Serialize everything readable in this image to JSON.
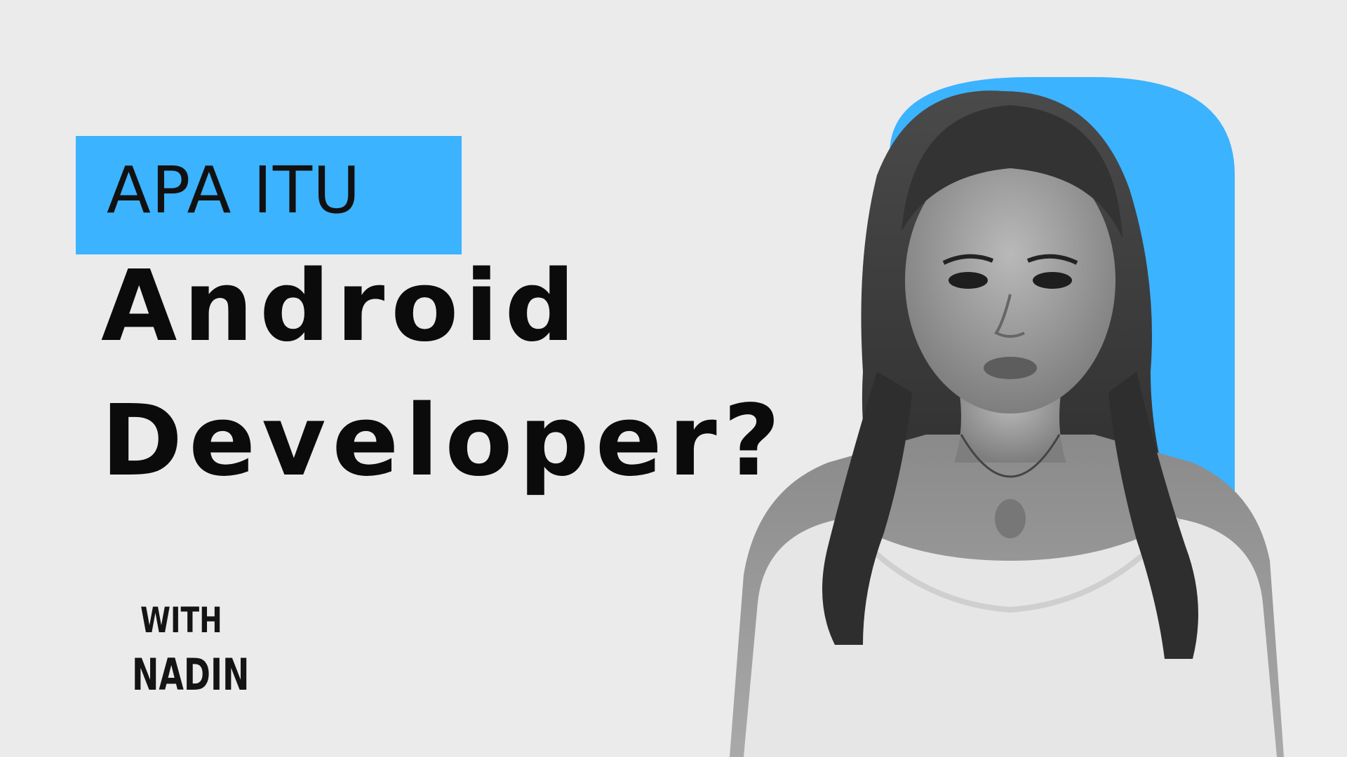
{
  "thumbnail": {
    "kicker": "APA ITU",
    "headline_line1": "Android",
    "headline_line2": "Developer?",
    "byline_line1": "WITH",
    "byline_line2": "NADIN"
  },
  "colors": {
    "background": "#ebebeb",
    "accent": "#3bb3ff",
    "text": "#0b0b0b"
  },
  "portrait": {
    "description_icon": "person-portrait-icon"
  }
}
